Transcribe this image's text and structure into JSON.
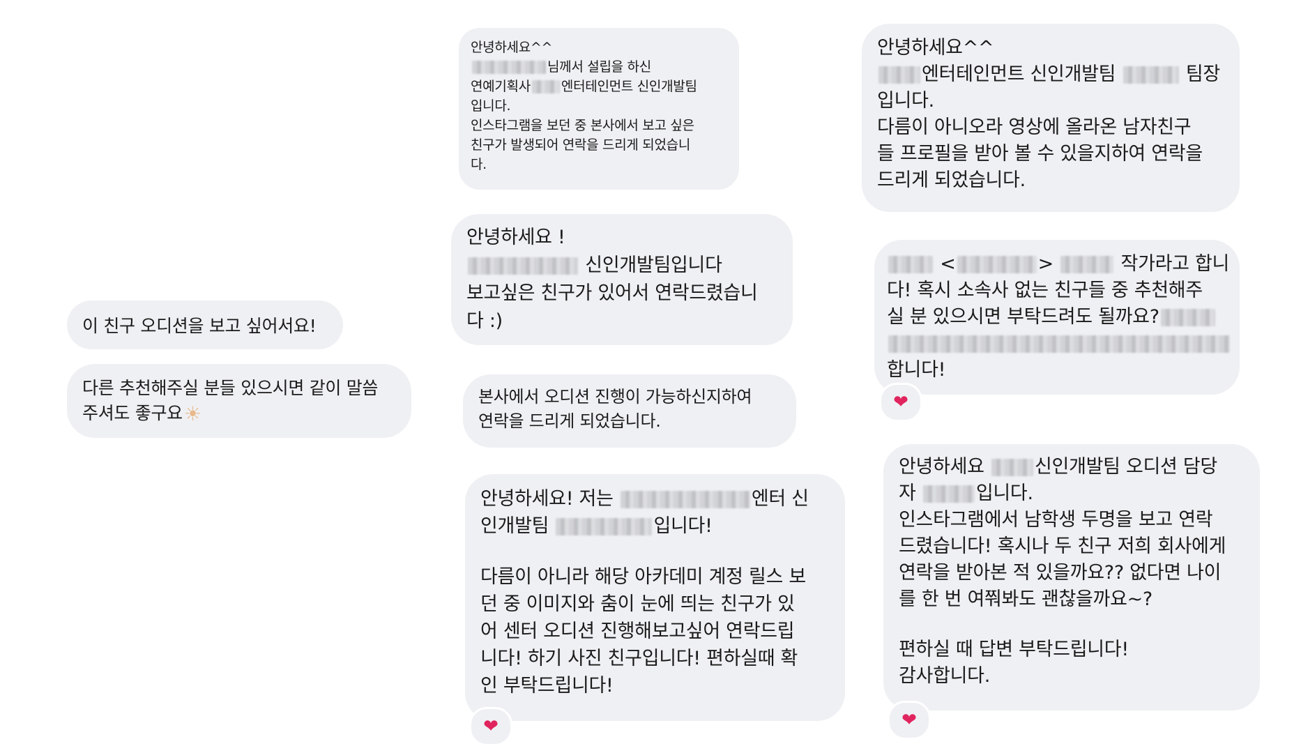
{
  "left": {
    "msg1": "이 친구 오디션을 보고 싶어서요!",
    "msg2": [
      "다른 추천해주실 분들 있으시면 같이 말씀",
      "주셔도 좋구요"
    ],
    "thumb_icon": "thumbs-up"
  },
  "middle": {
    "msg1": [
      "안녕하세요^^",
      "님께서 설립을 하신",
      "연예기획사",
      "엔터테인먼트 신인개발팀",
      "입니다.",
      "인스타그램을 보던 중 본사에서 보고 싶은",
      "친구가 발생되어 연락을 드리게 되었습니",
      "다."
    ],
    "msg2": [
      "안녕하세요 !",
      "신인개발팀입니다",
      "보고싶은 친구가 있어서 연락드렸습니",
      "다 :)"
    ],
    "msg3": [
      "본사에서 오디션 진행이 가능하신지하여",
      "연락을 드리게 되었습니다."
    ],
    "msg4": [
      "안녕하세요! 저는",
      "엔터 신",
      "인개발팀",
      "입니다!",
      "다름이 아니라 해당 아카데미 계정 릴스 보",
      "던 중 이미지와 춤이 눈에 띄는 친구가 있",
      "어 센터 오디션 진행해보고싶어 연락드립",
      "니다! 하기 사진 친구입니다! 편하실때 확",
      "인 부탁드립니다!"
    ],
    "reaction": "❤"
  },
  "right": {
    "msg1": [
      "안녕하세요^^",
      "엔터테인먼트 신인개발팀",
      "팀장",
      "입니다.",
      "다름이 아니오라 영상에 올라온 남자친구",
      "들 프로필을 받아 볼 수 있을지하여 연락을",
      "드리게 되었습니다."
    ],
    "msg2": [
      "<",
      ">",
      "작가라고 합니",
      "다! 혹시 소속사 없는 친구들 중 추천해주",
      "실 분 있으시면 부탁드려도 될까요?",
      "합니다!"
    ],
    "msg2_reaction": "❤",
    "msg3": [
      "안녕하세요",
      "신인개발팀 오디션 담당",
      "자",
      "입니다.",
      "인스타그램에서 남학생 두명을 보고 연락",
      "드렸습니다! 혹시나 두 친구 저희 회사에게",
      "연락을 받아본 적 있을까요?? 없다면 나이",
      "를 한 번 여쭤봐도 괜찮을까요~?",
      "편하실 때 답변 부탁드립니다!",
      "감사합니다."
    ],
    "msg3_reaction": "❤"
  }
}
